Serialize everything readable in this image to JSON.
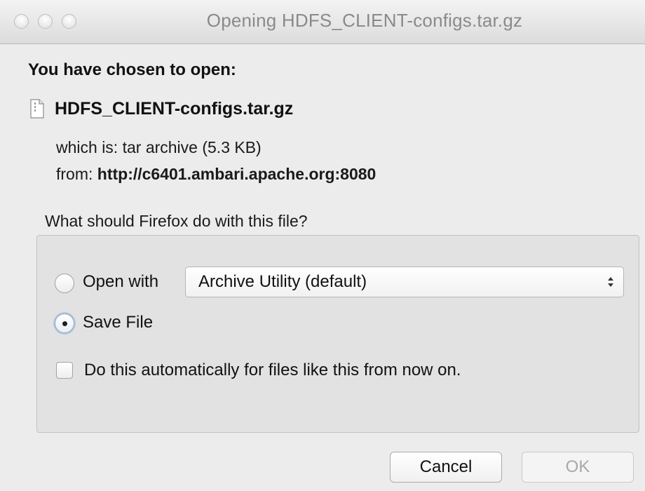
{
  "window": {
    "title": "Opening HDFS_CLIENT-configs.tar.gz"
  },
  "dialog": {
    "heading": "You have chosen to open:",
    "file": {
      "name": "HDFS_CLIENT-configs.tar.gz",
      "icon": "document-icon"
    },
    "type_line": "which is: tar archive (5.3 KB)",
    "from_label": "from:",
    "from_url": "http://c6401.ambari.apache.org:8080",
    "question": "What should Firefox do with this file?"
  },
  "options": {
    "open_with_label": "Open with",
    "open_with_app": "Archive Utility (default)",
    "save_file_label": "Save File",
    "selected": "save_file",
    "auto_label": "Do this automatically for files like this from now on.",
    "auto_checked": false
  },
  "buttons": {
    "cancel": "Cancel",
    "ok": "OK"
  }
}
